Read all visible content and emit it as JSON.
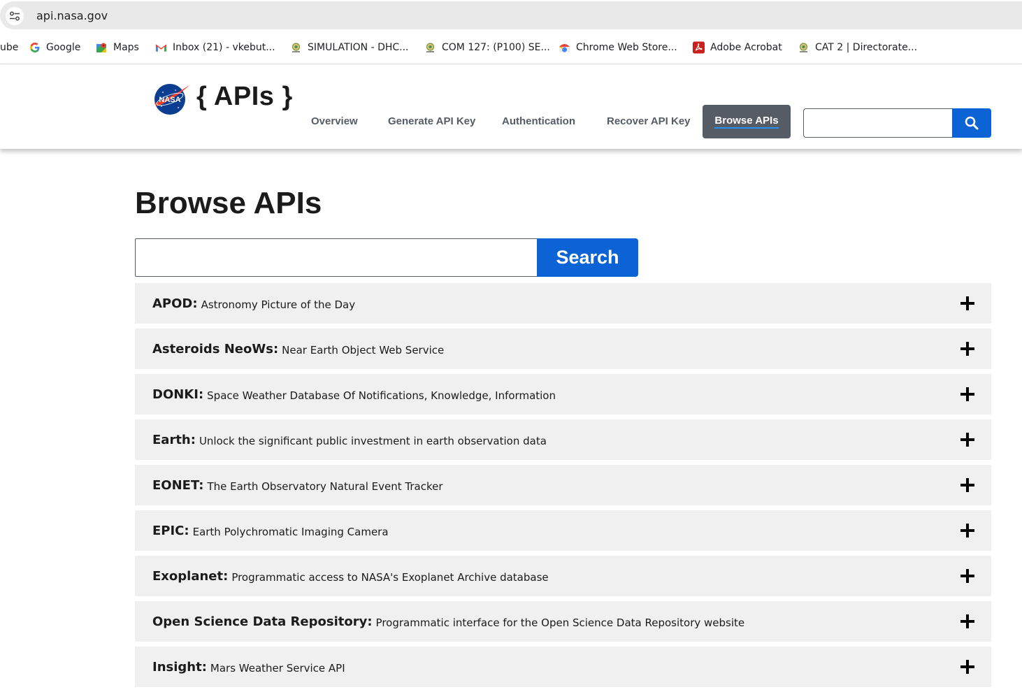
{
  "browser": {
    "url": "api.nasa.gov",
    "bookmarks": [
      {
        "label": "ube",
        "icon": "youtube-icon"
      },
      {
        "label": "Google",
        "icon": "google-icon"
      },
      {
        "label": "Maps",
        "icon": "maps-icon"
      },
      {
        "label": "Inbox (21) - vkebut...",
        "icon": "gmail-icon"
      },
      {
        "label": "SIMULATION - DHC...",
        "icon": "institution-icon"
      },
      {
        "label": "COM 127: (P100) SE...",
        "icon": "institution-icon"
      },
      {
        "label": "Chrome Web Store...",
        "icon": "chrome-web-store-icon"
      },
      {
        "label": "Adobe Acrobat",
        "icon": "adobe-acrobat-icon"
      },
      {
        "label": "CAT 2 | Directorate...",
        "icon": "institution-icon"
      }
    ]
  },
  "header": {
    "brand": "{ APIs }",
    "logo_text": "NASA",
    "nav": [
      "Overview",
      "Generate API Key",
      "Authentication",
      "Recover API Key",
      "Browse APIs"
    ],
    "active_nav": "Browse APIs"
  },
  "main": {
    "title": "Browse APIs",
    "search_button": "Search",
    "apis": [
      {
        "name": "APOD:",
        "desc": "Astronomy Picture of the Day"
      },
      {
        "name": "Asteroids NeoWs:",
        "desc": "Near Earth Object Web Service"
      },
      {
        "name": "DONKI:",
        "desc": "Space Weather Database Of Notifications, Knowledge, Information"
      },
      {
        "name": "Earth:",
        "desc": "Unlock the significant public investment in earth observation data"
      },
      {
        "name": "EONET:",
        "desc": "The Earth Observatory Natural Event Tracker"
      },
      {
        "name": "EPIC:",
        "desc": "Earth Polychromatic Imaging Camera"
      },
      {
        "name": "Exoplanet:",
        "desc": "Programmatic access to NASA's Exoplanet Archive database"
      },
      {
        "name": "Open Science Data Repository:",
        "desc": "Programmatic interface for the Open Science Data Repository website"
      },
      {
        "name": "Insight:",
        "desc": "Mars Weather Service API"
      }
    ]
  },
  "colors": {
    "primary_button": "#0b63d6",
    "active_nav_bg": "#565c65",
    "accordion_bg": "#f0f0f0"
  }
}
